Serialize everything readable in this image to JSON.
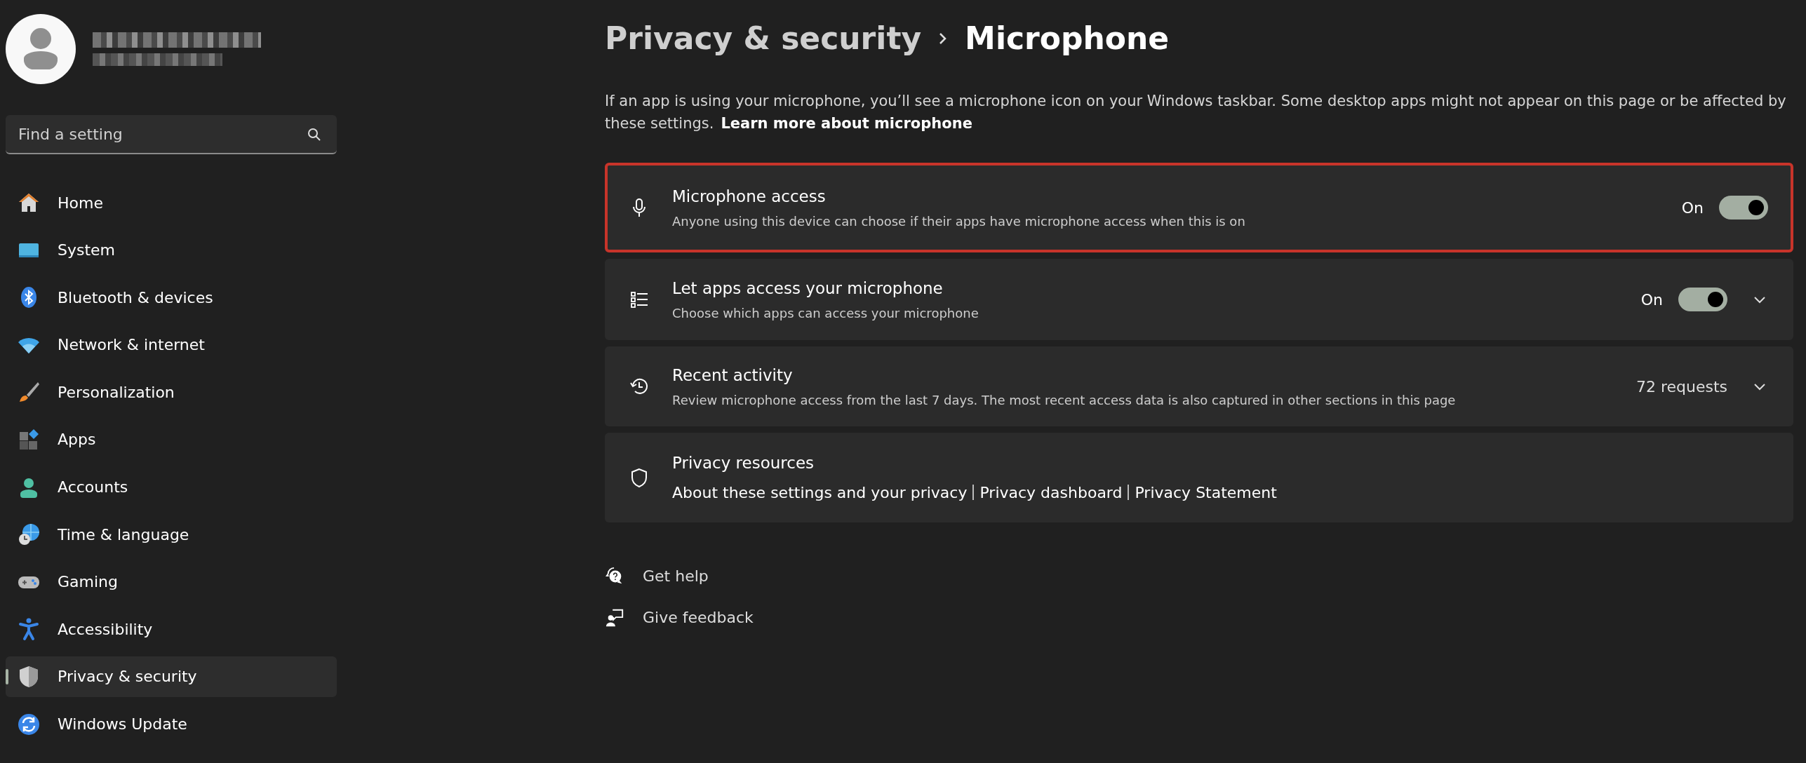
{
  "search": {
    "placeholder": "Find a setting"
  },
  "nav": [
    {
      "label": "Home",
      "selected": false
    },
    {
      "label": "System",
      "selected": false
    },
    {
      "label": "Bluetooth & devices",
      "selected": false
    },
    {
      "label": "Network & internet",
      "selected": false
    },
    {
      "label": "Personalization",
      "selected": false
    },
    {
      "label": "Apps",
      "selected": false
    },
    {
      "label": "Accounts",
      "selected": false
    },
    {
      "label": "Time & language",
      "selected": false
    },
    {
      "label": "Gaming",
      "selected": false
    },
    {
      "label": "Accessibility",
      "selected": false
    },
    {
      "label": "Privacy & security",
      "selected": true
    },
    {
      "label": "Windows Update",
      "selected": false
    }
  ],
  "breadcrumb": {
    "parent": "Privacy & security",
    "current": "Microphone"
  },
  "description": {
    "text": "If an app is using your microphone, you’ll see a microphone icon on your Windows taskbar. Some desktop apps might not appear on this page or be affected by these settings.",
    "link": "Learn more about microphone"
  },
  "cards": [
    {
      "kind": "toggle",
      "title": "Microphone access",
      "subtitle": "Anyone using this device can choose if their apps have microphone access when this is on",
      "state_label": "On",
      "on": true,
      "highlighted": true,
      "expandable": false
    },
    {
      "kind": "toggle",
      "title": "Let apps access your microphone",
      "subtitle": "Choose which apps can access your microphone",
      "state_label": "On",
      "on": true,
      "highlighted": false,
      "expandable": true
    },
    {
      "kind": "count",
      "title": "Recent activity",
      "subtitle": "Review microphone access from the last 7 days. The most recent access data is also captured in other sections in this page",
      "value": "72 requests",
      "highlighted": false,
      "expandable": true
    },
    {
      "kind": "links",
      "title": "Privacy resources",
      "links": [
        "About these settings and your privacy",
        "Privacy dashboard",
        "Privacy Statement"
      ],
      "highlighted": false
    }
  ],
  "help_links": [
    "Get help",
    "Give feedback"
  ]
}
